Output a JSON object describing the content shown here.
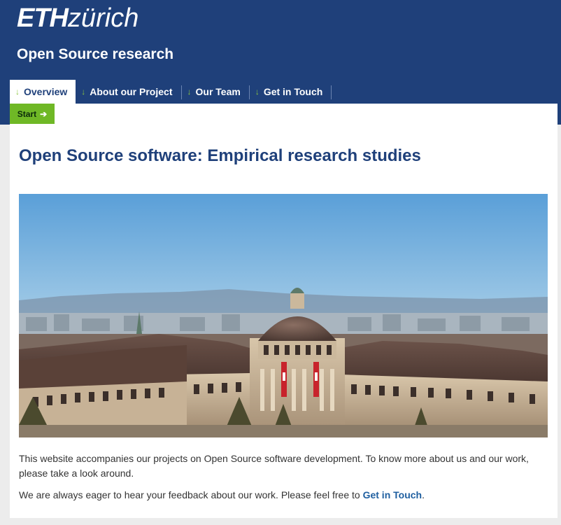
{
  "brand": {
    "logo_eth": "ETH",
    "logo_zurich": "zürich"
  },
  "site_title": "Open Source research",
  "nav": [
    {
      "label": "Overview",
      "active": true
    },
    {
      "label": "About our Project"
    },
    {
      "label": "Our Team"
    },
    {
      "label": "Get in Touch"
    }
  ],
  "start_button": {
    "label": "Start"
  },
  "page_title": "Open Source software: Empirical research studies",
  "hero_image": {
    "icon": "eth-main-building-photo"
  },
  "paragraphs": {
    "p1": "This website accompanies our projects on Open Source software development. To know more about us and our work, please take a look around.",
    "p2_text": "We are always eager to hear your feedback about our work. Please feel free to ",
    "p2_link": "Get in Touch",
    "p2_end": "."
  },
  "colors": {
    "header_bg": "#1f407a",
    "accent_green": "#6fb826",
    "title_blue": "#1f407a"
  }
}
